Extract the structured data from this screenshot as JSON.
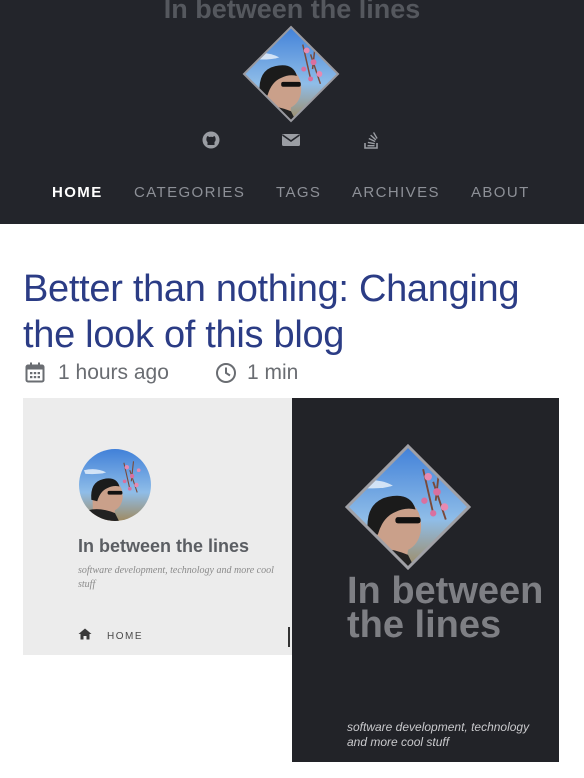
{
  "header": {
    "site_title": "In between the lines",
    "social_icons": [
      "github-icon",
      "envelope-icon",
      "stack-overflow-icon"
    ]
  },
  "nav": {
    "items": [
      {
        "label": "HOME",
        "active": true
      },
      {
        "label": "CATEGORIES",
        "active": false
      },
      {
        "label": "TAGS",
        "active": false
      },
      {
        "label": "ARCHIVES",
        "active": false
      },
      {
        "label": "ABOUT",
        "active": false
      }
    ]
  },
  "post": {
    "title": "Better than nothing: Changing the look of this blog",
    "date": "1 hours ago",
    "reading_time": "1 min"
  },
  "comparison_image": {
    "before": {
      "title": "In between the lines",
      "subtitle": "software development, technology and more cool stuff",
      "nav_home": "HOME"
    },
    "after": {
      "title": "In between the lines",
      "subtitle": "software development, technology and more cool stuff"
    }
  },
  "colors": {
    "header_bg": "#23252b",
    "post_title": "#2b3c85",
    "nav_active": "#ffffff",
    "nav_inactive": "#8d9097"
  }
}
